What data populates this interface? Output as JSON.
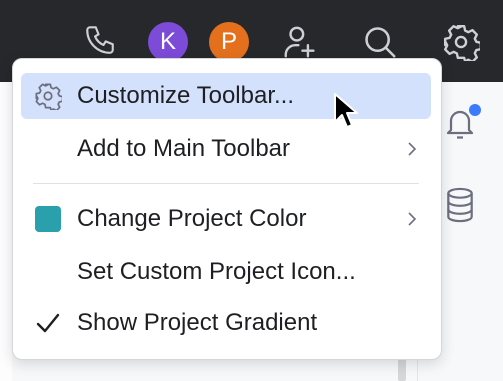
{
  "toolbar": {
    "avatars": [
      {
        "letter": "K",
        "color": "#7c4bd8"
      },
      {
        "letter": "P",
        "color": "#e4701e"
      }
    ],
    "icons": [
      "phone-icon",
      "add-user-icon",
      "search-icon",
      "settings-gear-icon"
    ]
  },
  "side_panel": {
    "icons": [
      "notifications-bell-icon",
      "database-icon"
    ],
    "notification_dot_color": "#3d7bfd"
  },
  "menu": {
    "items": [
      {
        "label": "Customize Toolbar...",
        "icon": "settings-gear-icon",
        "highlighted": true
      },
      {
        "label": "Add to Main Toolbar",
        "submenu": true
      },
      {
        "label": "Change Project Color",
        "icon": "color-swatch",
        "swatch_color": "#2aa0ac",
        "submenu": true
      },
      {
        "label": "Set Custom Project Icon..."
      },
      {
        "label": "Show Project Gradient",
        "icon": "checkmark-icon",
        "checked": true
      }
    ],
    "highlight_color": "#d4e1fd"
  }
}
